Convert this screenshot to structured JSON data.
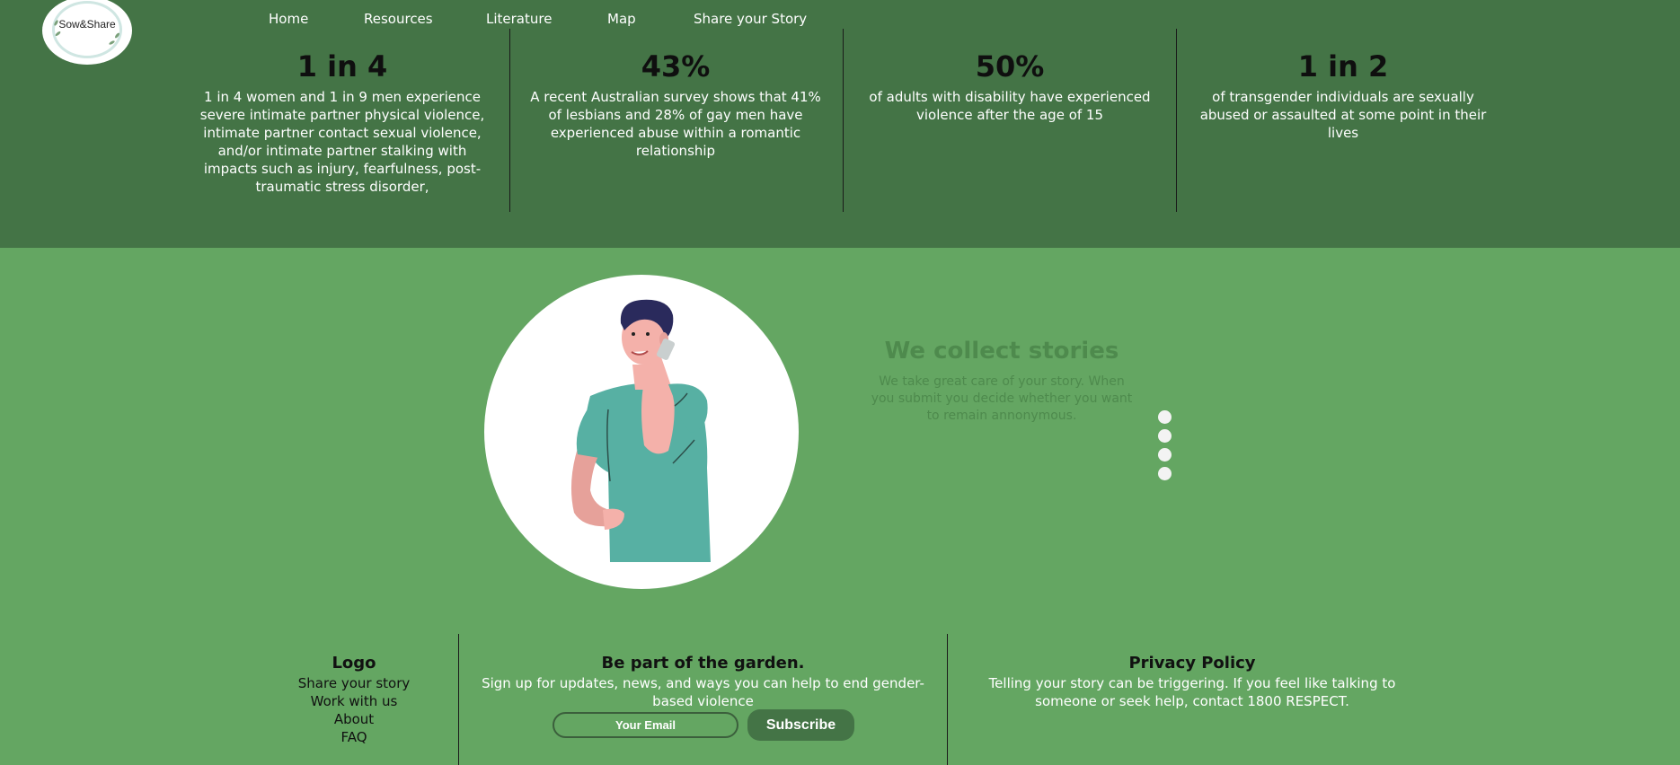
{
  "brand": {
    "logo_text": "Sow&Share"
  },
  "nav": {
    "items": [
      {
        "label": "Home"
      },
      {
        "label": "Resources"
      },
      {
        "label": "Literature"
      },
      {
        "label": "Map"
      },
      {
        "label": "Share your Story"
      }
    ]
  },
  "stats": [
    {
      "value": "1 in 4",
      "description": "1 in 4 women and 1 in 9 men experience severe intimate partner physical violence, intimate partner contact sexual violence, and/or intimate partner stalking with impacts such as injury, fearfulness, post-traumatic stress disorder,"
    },
    {
      "value": "43%",
      "description": "A recent Australian survey shows that 41% of lesbians and 28% of gay men have experienced abuse within a romantic relationship"
    },
    {
      "value": "50%",
      "description": "of adults with disability have experienced violence after the age of 15"
    },
    {
      "value": "1 in 2",
      "description": "of transgender individuals are sexually abused or assaulted at some point in their lives"
    }
  ],
  "carousel": {
    "title": "We collect stories",
    "text": "We take great care of your story. When you submit you decide whether you want to remain annonymous.",
    "slide_count": 4
  },
  "footer": {
    "logo_col": {
      "title": "Logo",
      "links": [
        "Share your story",
        "Work with us",
        "About",
        "FAQ"
      ]
    },
    "signup": {
      "title": "Be part of the garden.",
      "text": "Sign up for updates, news, and ways you can help to end gender-based violence",
      "email_placeholder": "Your Email",
      "button_label": "Subscribe"
    },
    "privacy": {
      "title": "Privacy Policy",
      "text": "Telling your story can be triggering. If you feel like talking to someone or seek help, contact 1800 RESPECT."
    }
  },
  "colors": {
    "dark_green": "#447446",
    "light_green": "#64a662",
    "muted_green_text": "#4e8a4d",
    "white": "#ffffff"
  }
}
